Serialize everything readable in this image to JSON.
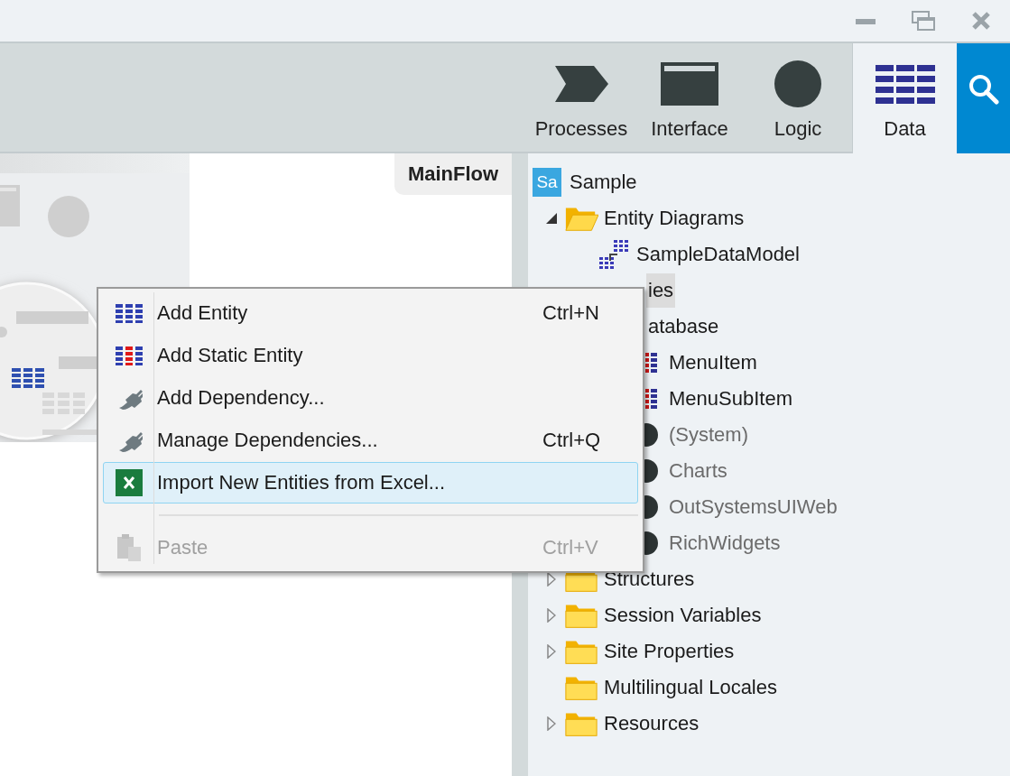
{
  "toolbar": {
    "tabs": [
      {
        "label": "Processes",
        "kind": "processes",
        "selected": false
      },
      {
        "label": "Interface",
        "kind": "interface",
        "selected": false
      },
      {
        "label": "Logic",
        "kind": "logic",
        "selected": false
      },
      {
        "label": "Data",
        "kind": "data",
        "selected": true
      }
    ]
  },
  "canvas": {
    "flow_tab": "MainFlow"
  },
  "tree": {
    "items": [
      {
        "label": "Sample",
        "kind": "app",
        "badge": "Sa",
        "selected": false,
        "children": [
          {
            "label": "Entity Diagrams",
            "kind": "folder",
            "expanded": true,
            "selected": false,
            "children": [
              {
                "label": "SampleDataModel",
                "kind": "diagram",
                "selected": false
              }
            ]
          },
          {
            "label": "ies",
            "kind": "folder",
            "expanded": true,
            "selected": true,
            "clipped": true,
            "children": [
              {
                "label": "atabase",
                "kind": "folder",
                "expanded": true,
                "selected": false,
                "clipped": true,
                "children": [
                  {
                    "label": "MenuItem",
                    "kind": "static-entity",
                    "selected": false
                  },
                  {
                    "label": "MenuSubItem",
                    "kind": "static-entity",
                    "selected": false
                  },
                  {
                    "label": "(System)",
                    "kind": "module",
                    "selected": false
                  },
                  {
                    "label": "Charts",
                    "kind": "module",
                    "selected": false
                  },
                  {
                    "label": "OutSystemsUIWeb",
                    "kind": "module",
                    "selected": false
                  },
                  {
                    "label": "RichWidgets",
                    "kind": "module",
                    "selected": false
                  }
                ]
              }
            ]
          },
          {
            "label": "Structures",
            "kind": "folder",
            "expanded": false,
            "selected": false
          },
          {
            "label": "Session Variables",
            "kind": "folder",
            "expanded": false,
            "selected": false
          },
          {
            "label": "Site Properties",
            "kind": "folder",
            "expanded": false,
            "selected": false
          },
          {
            "label": "Multilingual Locales",
            "kind": "folder",
            "selected": false
          },
          {
            "label": "Resources",
            "kind": "folder",
            "expanded": false,
            "selected": false
          }
        ]
      }
    ]
  },
  "context_menu": {
    "items": [
      {
        "kind": "entity",
        "label": "Add Entity",
        "shortcut": "Ctrl+N",
        "selected": false,
        "disabled": false
      },
      {
        "kind": "static-entity",
        "label": "Add Static Entity",
        "selected": false,
        "disabled": false
      },
      {
        "kind": "plug",
        "label": "Add Dependency...",
        "selected": false,
        "disabled": false
      },
      {
        "kind": "plug",
        "label": "Manage Dependencies...",
        "shortcut": "Ctrl+Q",
        "selected": false,
        "disabled": false
      },
      {
        "kind": "excel",
        "label": "Import New Entities from Excel...",
        "selected": true,
        "disabled": false
      },
      {
        "kind": "separator"
      },
      {
        "kind": "paste",
        "label": "Paste",
        "shortcut": "Ctrl+V",
        "selected": false,
        "disabled": true
      }
    ]
  }
}
